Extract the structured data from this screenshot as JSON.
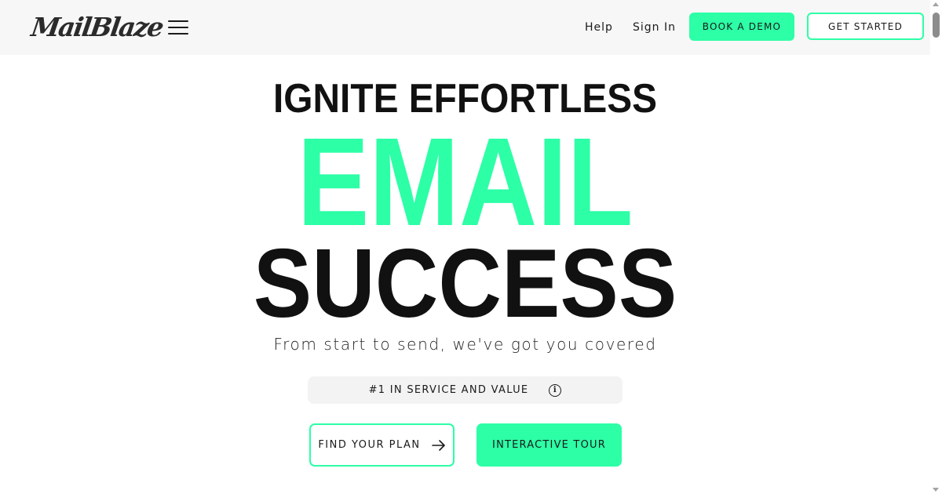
{
  "header": {
    "logo_text": "MailBlaze",
    "nav": {
      "help_label": "Help",
      "signin_label": "Sign In"
    },
    "book_demo_label": "BOOK A DEMO",
    "get_started_label": "GET STARTED"
  },
  "hero": {
    "line1": "IGNITE EFFORTLESS",
    "line2": "EMAIL",
    "line3": "SUCCESS",
    "subtitle": "From start to send, we've got you covered"
  },
  "badge": {
    "text": "#1 IN SERVICE AND VALUE",
    "icon_glyph": "i"
  },
  "cta": {
    "find_plan_label": "FIND YOUR PLAN",
    "tour_label": "INTERACTIVE TOUR"
  },
  "icons": {
    "menu": "menu-icon",
    "info": "info-icon",
    "arrow": "arrow-right-icon"
  },
  "colors": {
    "accent": "#2cffa6",
    "text": "#111111",
    "header_bg": "#f7f7f7"
  }
}
